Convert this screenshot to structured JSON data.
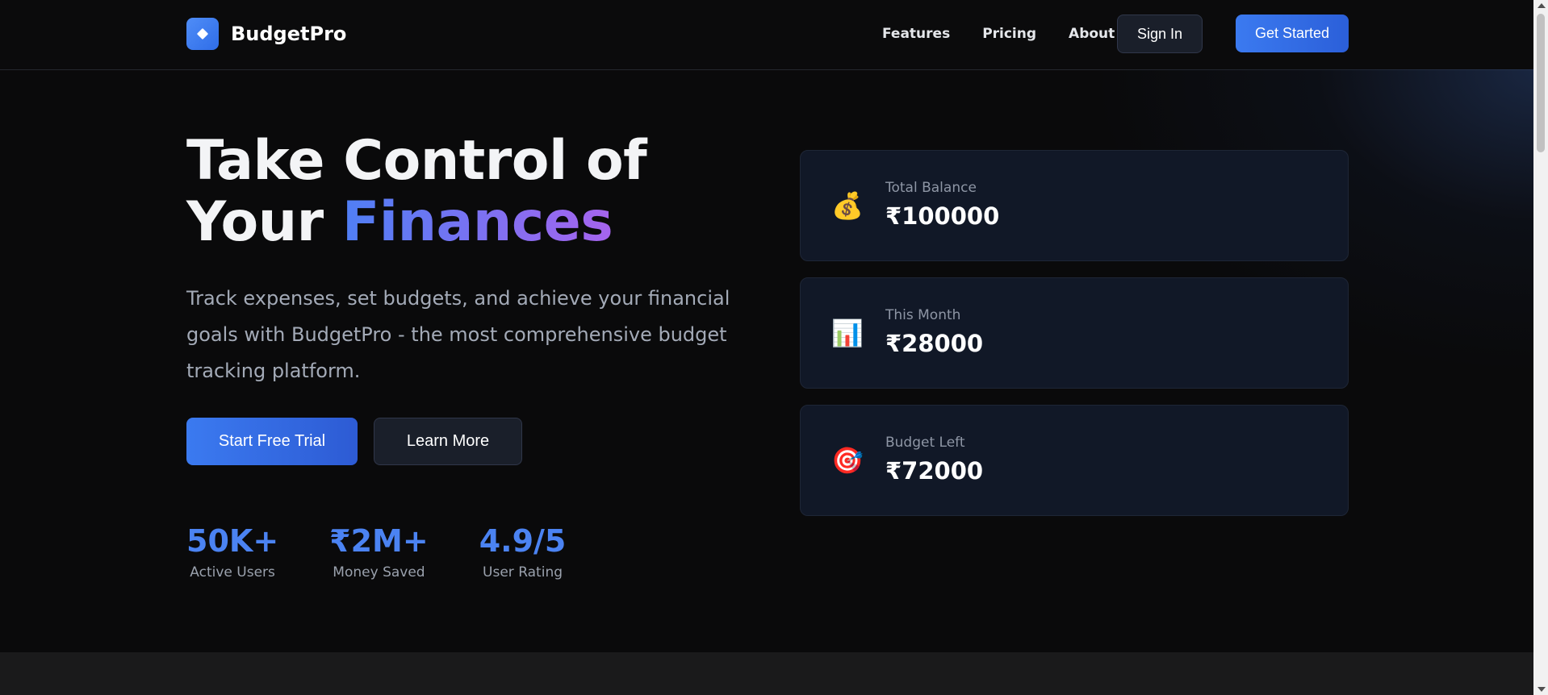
{
  "brand": {
    "name": "BudgetPro",
    "logo_icon": "diamond-icon"
  },
  "nav": {
    "links": [
      "Features",
      "Pricing",
      "About"
    ],
    "sign_in": "Sign In",
    "get_started": "Get Started"
  },
  "hero": {
    "title_line1": "Take Control of",
    "title_line2_plain": "Your",
    "title_line2_accent": "Finances",
    "description": "Track expenses, set budgets, and achieve your financial goals with BudgetPro - the most comprehensive budget tracking platform.",
    "primary_cta": "Start Free Trial",
    "secondary_cta": "Learn More"
  },
  "stats": [
    {
      "value": "50K+",
      "label": "Active Users"
    },
    {
      "value": "₹2M+",
      "label": "Money Saved"
    },
    {
      "value": "4.9/5",
      "label": "User Rating"
    }
  ],
  "cards": [
    {
      "label": "Total Balance",
      "value": "₹100000",
      "icon": "money-bag-icon",
      "glyph": "💰"
    },
    {
      "label": "This Month",
      "value": "₹28000",
      "icon": "bar-chart-icon",
      "glyph": "📊"
    },
    {
      "label": "Budget Left",
      "value": "₹72000",
      "icon": "target-icon",
      "glyph": "🎯"
    }
  ],
  "colors": {
    "accent_blue": "#3b7af0",
    "accent_purple": "#a664ee",
    "background": "#0a0a0b",
    "card_bg": "#111827"
  }
}
